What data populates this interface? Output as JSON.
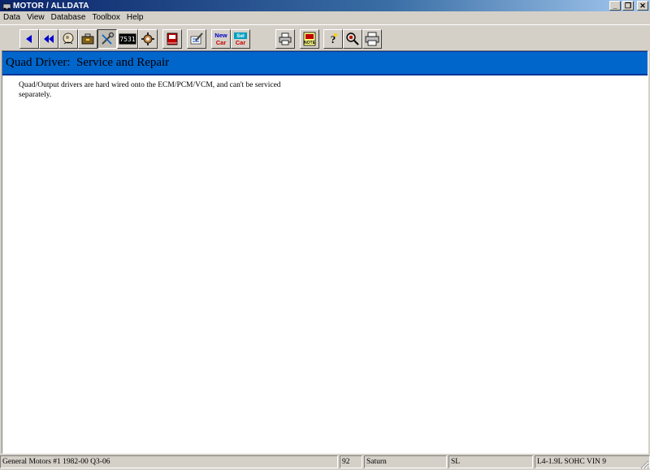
{
  "window": {
    "title": "MOTOR / ALLDATA"
  },
  "menu": [
    "Data",
    "View",
    "Database",
    "Toolbox",
    "Help"
  ],
  "toolbar": {
    "car_new_1": "New",
    "car_new_2": "Car",
    "car_sel_1": "Sel",
    "car_sel_2": "Car",
    "note_label": "NOTE",
    "code_label": "7531"
  },
  "section": {
    "title": "Quad Driver:  Service and Repair"
  },
  "body": {
    "line1": "Quad/Output drivers are hard wired onto the ECM/PCM/VCM, and can't be serviced",
    "line2": "separately."
  },
  "status": {
    "database": "General Motors #1 1982-00 Q3-06",
    "year": "92",
    "make": "Saturn",
    "model": "SL",
    "engine": "L4-1.9L SOHC VIN 9"
  },
  "colors": {
    "header_blue": "#0066cc",
    "title_blue": "#0a246a"
  }
}
